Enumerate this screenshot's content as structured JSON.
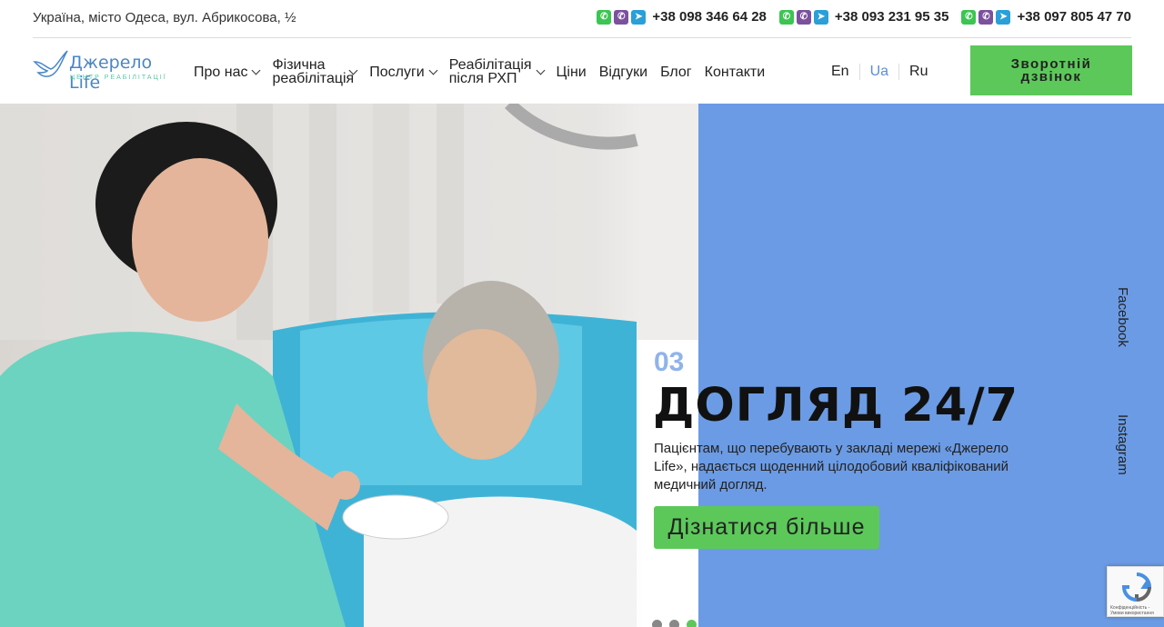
{
  "topbar": {
    "address": "Україна, місто Одеса, вул. Абрикосова, ½",
    "phones": [
      "+38 098 346 64 28",
      "+38 093 231 95 35",
      "+38 097 805 47 70"
    ]
  },
  "logo": {
    "name": "Джерело Life",
    "sub": "ЦЕНТР РЕАБІЛІТАЦІЇ"
  },
  "menu": {
    "about": "Про нас",
    "physical_1": "Фізична",
    "physical_2": "реабілітація",
    "services": "Послуги",
    "rehab_1": "Реабілітація",
    "rehab_2": "після РХП",
    "prices": "Ціни",
    "reviews": "Відгуки",
    "blog": "Блог",
    "contacts": "Контакти"
  },
  "langs": {
    "en": "En",
    "ua": "Ua",
    "ru": "Ru"
  },
  "cta": {
    "line1": "Зворотній",
    "line2": "дзвінок"
  },
  "hero": {
    "slide_number": "03",
    "title": "ДОГЛЯД 24/7",
    "text": "Пацієнтам, що перебувають у закладі мережі «Джерело Life», надається щоденний цілодобовий кваліфікований медичний догляд.",
    "button": "Дізнатися більше"
  },
  "social": {
    "facebook": "Facebook",
    "instagram": "Instagram"
  },
  "recaptcha": {
    "text": "Конфіденційність - Умови використання"
  },
  "colors": {
    "accent_green": "#5cc85a",
    "accent_blue": "#6b9be4"
  }
}
